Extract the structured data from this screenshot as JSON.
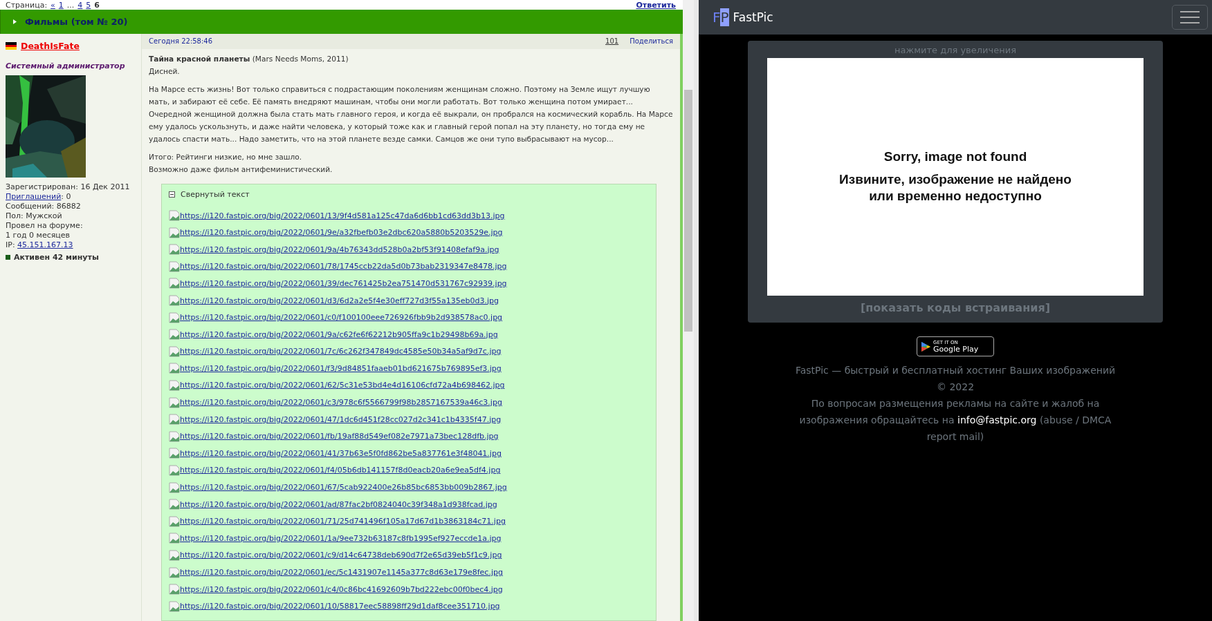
{
  "pagination": {
    "label": "Страница:",
    "items": [
      {
        "kind": "link",
        "text": "«"
      },
      {
        "kind": "link",
        "text": "1"
      },
      {
        "kind": "text",
        "text": "..."
      },
      {
        "kind": "link",
        "text": "4"
      },
      {
        "kind": "link",
        "text": "5"
      },
      {
        "kind": "current",
        "text": "6"
      }
    ],
    "reply": "Ответить"
  },
  "forum_header": {
    "title": "Фильмы (том № 20)"
  },
  "author": {
    "name": "DeathIsFate",
    "rank": "Системный администратор",
    "details": [
      {
        "kind": "text",
        "text": "Зарегистрирован: 16 Дек 2011"
      },
      {
        "kind": "link",
        "label": "Приглашений",
        "value": ": 0"
      },
      {
        "kind": "text",
        "text": "Сообщений: 86882"
      },
      {
        "kind": "text",
        "text": "Пол: Мужской"
      },
      {
        "kind": "text",
        "text": "Провел на форуме:"
      },
      {
        "kind": "text",
        "text": "1 год 0 месяцев"
      },
      {
        "kind": "link",
        "prefix": "IP: ",
        "label": "45.151.167.13"
      },
      {
        "kind": "status",
        "text": "Активен 42 минуты"
      }
    ]
  },
  "post": {
    "time": "Сегодня 22:58:46",
    "number": "101",
    "share": "Поделиться",
    "paragraphs": [
      "**Тайна красной планеты** (Mars Needs Moms, 2011)\nДисней.",
      "На Марсе есть жизнь! Вот только справиться с подрастающим поколениям женщинам сложно. Поэтому на Земле ищут лучшую мать, и забирают её себе. Её память внедряют машинам, чтобы они могли работать. Вот только женщина потом умирает... Очередной женщиной должна была стать мать главного героя, и когда её выкрали, он пробрался на космический корабль. На Марсе ему удалось ускользнуть, и даже найти человека, у который тоже как и главный герой попал на эту планету, но тогда ему не удалось спасти мать... Надо заметить, что на этой планете везде самки. Самцов же они тупо выбрасывают на мусор...",
      "Итого: Рейтинги низкие, но мне зашло.\nВозможно даже фильм антифеминистический."
    ],
    "spoiler": {
      "title": "Свернутый текст",
      "expanded": true,
      "links": [
        "https://i120.fastpic.org/big/2022/0601/13/9f4d581a125c47da6d6bb1cd63dd3b13.jpg",
        "https://i120.fastpic.org/big/2022/0601/9e/a32fbefb03e2dbc620a5880b5203529e.jpg",
        "https://i120.fastpic.org/big/2022/0601/9a/4b76343dd528b0a2bf53f91408efaf9a.jpg",
        "https://i120.fastpic.org/big/2022/0601/78/1745ccb22da5d0b73bab2319347e8478.jpg",
        "https://i120.fastpic.org/big/2022/0601/39/dec761425b2ea751470d531767c92939.jpg",
        "https://i120.fastpic.org/big/2022/0601/d3/6d2a2e5f4e30eff727d3f55a135eb0d3.jpg",
        "https://i120.fastpic.org/big/2022/0601/c0/f100100eee726926fbb9b2d938578ac0.jpg",
        "https://i120.fastpic.org/big/2022/0601/9a/c62fe6f62212b905ffa9c1b29498b69a.jpg",
        "https://i120.fastpic.org/big/2022/0601/7c/6c262f347849dc4585e50b34a5af9d7c.jpg",
        "https://i120.fastpic.org/big/2022/0601/f3/9d84851faaeb01bd621675b769895ef3.jpg",
        "https://i120.fastpic.org/big/2022/0601/62/5c31e53bd4e4d16106cfd72a4b698462.jpg",
        "https://i120.fastpic.org/big/2022/0601/c3/978c6f5566799f98b2857167539a46c3.jpg",
        "https://i120.fastpic.org/big/2022/0601/47/1dc6d451f28cc027d2c341c1b4335f47.jpg",
        "https://i120.fastpic.org/big/2022/0601/fb/19af88d549ef082e7971a73bec128dfb.jpg",
        "https://i120.fastpic.org/big/2022/0601/41/37b63e5f0fd862be5a837761e3f48041.jpg",
        "https://i120.fastpic.org/big/2022/0601/f4/05b6db141157f8d0eacb20a6e9ea5df4.jpg",
        "https://i120.fastpic.org/big/2022/0601/67/5cab922400e26b85bc6853bb009b2867.jpg",
        "https://i120.fastpic.org/big/2022/0601/ad/87fac2bf0824040c39f348a1d938fcad.jpg",
        "https://i120.fastpic.org/big/2022/0601/71/25d741496f105a17d67d1b3863184c71.jpg",
        "https://i120.fastpic.org/big/2022/0601/1a/9ee732b63187c8fb1995ef927eccde1a.jpg",
        "https://i120.fastpic.org/big/2022/0601/c9/d14c64738deb690d7f2e65d39eb5f1c9.jpg",
        "https://i120.fastpic.org/big/2022/0601/ec/5c1431907e1145a377c8d63e179e8fec.jpg",
        "https://i120.fastpic.org/big/2022/0601/c4/0c86bc41692609b7bd222ebc00f0bec4.jpg",
        "https://i120.fastpic.org/big/2022/0601/10/58817eec58898ff29d1daf8cee351710.jpg"
      ]
    }
  },
  "fastpic": {
    "brand": {
      "logo": "FP",
      "name": "FastPic"
    },
    "hint": "нажмите для увеличения",
    "error": {
      "title": "Sorry, image not found",
      "message": "Извините, изображение не найдено\nили временно недоступно"
    },
    "embed_link": "[показать коды встраивания]",
    "badge": {
      "small": "GET IT ON",
      "big": "Google Play"
    },
    "footer": [
      "FastPic — быстрый и бесплатный хостинг Ваших изображений © 2022"
    ],
    "contact": {
      "before": "По вопросам размещения рекламы на сайте и жалоб на изображения обращайтесь на ",
      "email": "info@fastpic.org",
      "after": " (abuse / DMCA report mail)"
    }
  }
}
